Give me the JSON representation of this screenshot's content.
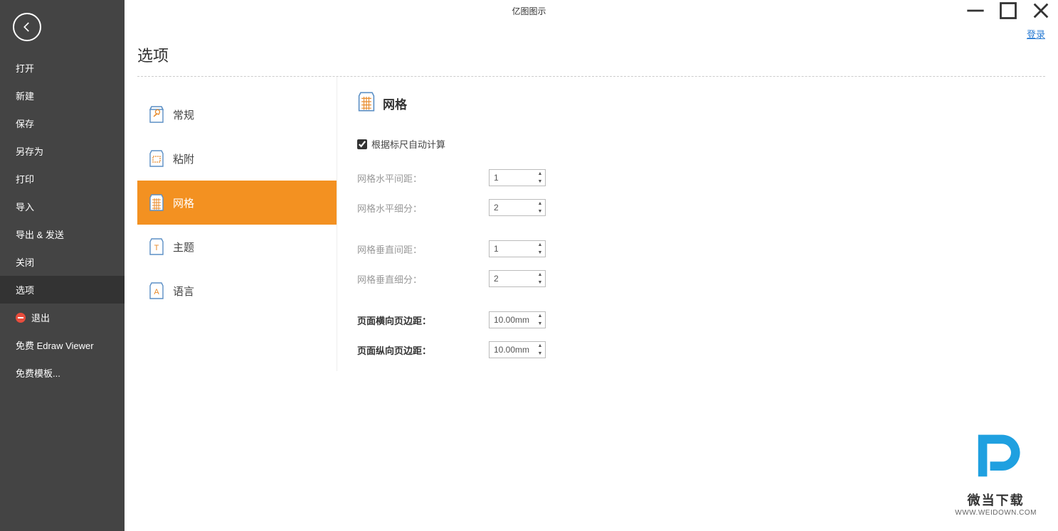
{
  "titlebar": {
    "title": "亿图图示"
  },
  "login_link": "登录",
  "sidebar": {
    "items": [
      {
        "label": "打开"
      },
      {
        "label": "新建"
      },
      {
        "label": "保存"
      },
      {
        "label": "另存为"
      },
      {
        "label": "打印"
      },
      {
        "label": "导入"
      },
      {
        "label": "导出 & 发送"
      },
      {
        "label": "关闭"
      },
      {
        "label": "选项"
      },
      {
        "label": "退出"
      },
      {
        "label": "免费 Edraw Viewer"
      },
      {
        "label": "免费模板..."
      }
    ]
  },
  "page": {
    "title": "选项"
  },
  "tabs": [
    {
      "label": "常规"
    },
    {
      "label": "粘附"
    },
    {
      "label": "网格"
    },
    {
      "label": "主题"
    },
    {
      "label": "语言"
    }
  ],
  "section": {
    "title": "网格",
    "checkbox_label": "根据标尺自动计算",
    "checkbox_checked": true,
    "rows": [
      {
        "label": "网格水平间距：",
        "value": "1",
        "strong": false,
        "group_end": false
      },
      {
        "label": "网格水平细分：",
        "value": "2",
        "strong": false,
        "group_end": true
      },
      {
        "label": "网格垂直间距：",
        "value": "1",
        "strong": false,
        "group_end": false
      },
      {
        "label": "网格垂直细分：",
        "value": "2",
        "strong": false,
        "group_end": true
      },
      {
        "label": "页面横向页边距：",
        "value": "10.00mm",
        "strong": true,
        "group_end": false
      },
      {
        "label": "页面纵向页边距：",
        "value": "10.00mm",
        "strong": true,
        "group_end": false
      }
    ]
  },
  "watermark": {
    "text": "微当下载",
    "url": "WWW.WEIDOWN.COM"
  }
}
